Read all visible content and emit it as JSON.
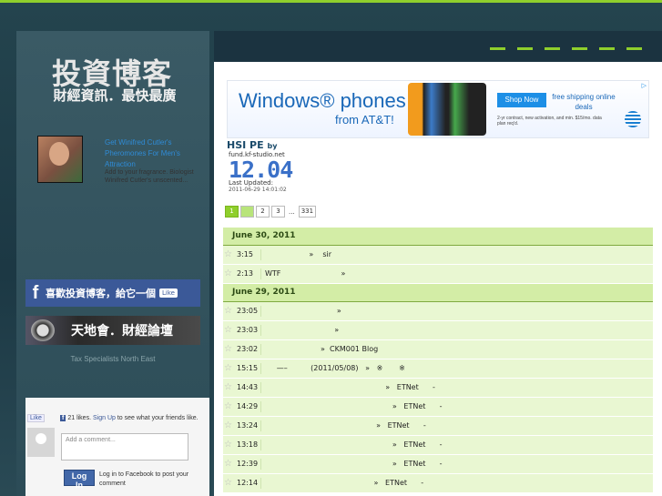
{
  "colors": {
    "accent": "#8fcf2c",
    "background": "#1c3844",
    "link": "#2f8bd6",
    "row_bg": "#e9f7d2",
    "header_bg": "#d3eda6"
  },
  "sidebar": {
    "logo_title": "投資博客",
    "logo_subtitle": "財經資訊．最快最廣",
    "ad": {
      "link_text": "Get Winifred Cutler's Pheromones For Men's Attraction",
      "body": "Add to your fragrance. Biologist Winifred Cutler's unscented..."
    },
    "fb_banner": {
      "text": "喜歡投資博客，給它一個",
      "like": "Like"
    },
    "forum_banner": {
      "text": "天地會．財經論壇"
    },
    "tax_link": "Tax Specialists North East",
    "fb_widget": {
      "like_btn": "Like",
      "count_icon": "f",
      "count_text": "21 likes.",
      "signup": "Sign Up",
      "friends_text": "to see what your friends like.",
      "comment_placeholder": "Add a comment...",
      "login_btn": "Log In",
      "login_text": "Log in to Facebook to post your comment"
    }
  },
  "ad_banner": {
    "title": "Windows® phones",
    "subtitle": "from AT&T!",
    "shop_btn": "Shop Now",
    "shipping": "free shipping online deals",
    "fineprint": "2-yr contract, new activation, and min. $15/mo. data plan req'd.",
    "adchoice": "▷"
  },
  "hsi": {
    "title": "HSI PE",
    "by": "by",
    "source": "fund.kf-studio.net",
    "value": "12.04",
    "updated_label": "Last Updated:",
    "updated": "2011-06-29 14:01:02"
  },
  "pager": {
    "pages": [
      "1",
      "2",
      "3"
    ],
    "dots": "...",
    "last": "331"
  },
  "days": [
    {
      "date": "June 30, 2011",
      "posts": [
        {
          "time": "3:15",
          "text": "                   »    sir"
        },
        {
          "time": "2:13",
          "text": "WTF                          »"
        }
      ]
    },
    {
      "date": "June 29, 2011",
      "posts": [
        {
          "time": "23:05",
          "text": "                               »"
        },
        {
          "time": "23:03",
          "text": "                              »"
        },
        {
          "time": "23:02",
          "text": "                        »  CKM001 Blog"
        },
        {
          "time": "15:15",
          "text": "     —–          (2011/05/08)   »   ※       ※"
        },
        {
          "time": "14:43",
          "text": "                                                    »   ETNet      -"
        },
        {
          "time": "14:29",
          "text": "                                                       »   ETNet      -"
        },
        {
          "time": "13:24",
          "text": "                                                »   ETNet      -"
        },
        {
          "time": "13:18",
          "text": "                                                       »   ETNet      -"
        },
        {
          "time": "12:39",
          "text": "                                                       »   ETNet      -"
        },
        {
          "time": "12:14",
          "text": "                                               »   ETNet      -"
        }
      ]
    }
  ]
}
